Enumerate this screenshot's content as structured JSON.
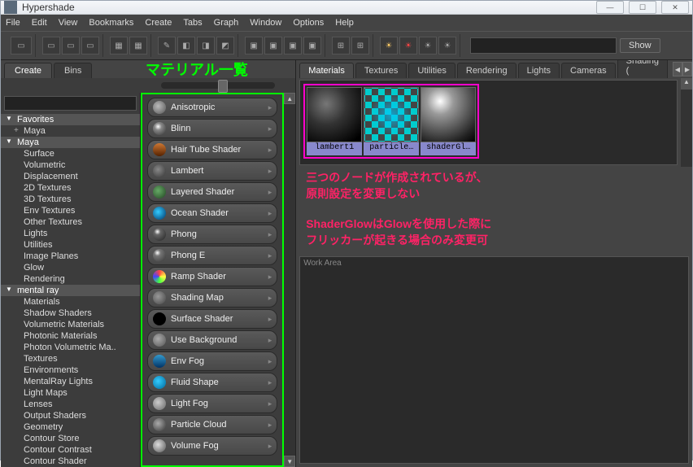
{
  "window": {
    "title": "Hypershade"
  },
  "menubar": [
    "File",
    "Edit",
    "View",
    "Bookmarks",
    "Create",
    "Tabs",
    "Graph",
    "Window",
    "Options",
    "Help"
  ],
  "toolbar": {
    "show": "Show"
  },
  "left": {
    "tabs": [
      {
        "label": "Create",
        "active": true
      },
      {
        "label": "Bins",
        "active": false
      }
    ],
    "annot_materials": "マテリアル一覧",
    "tree": [
      {
        "label": "Favorites",
        "type": "hdr"
      },
      {
        "label": "Maya",
        "type": "sub"
      },
      {
        "label": "Maya",
        "type": "hdr"
      },
      {
        "label": "Surface",
        "type": "leaf"
      },
      {
        "label": "Volumetric",
        "type": "leaf"
      },
      {
        "label": "Displacement",
        "type": "leaf"
      },
      {
        "label": "2D Textures",
        "type": "leaf"
      },
      {
        "label": "3D Textures",
        "type": "leaf"
      },
      {
        "label": "Env Textures",
        "type": "leaf"
      },
      {
        "label": "Other Textures",
        "type": "leaf"
      },
      {
        "label": "Lights",
        "type": "leaf"
      },
      {
        "label": "Utilities",
        "type": "leaf"
      },
      {
        "label": "Image Planes",
        "type": "leaf"
      },
      {
        "label": "Glow",
        "type": "leaf"
      },
      {
        "label": "Rendering",
        "type": "leaf"
      },
      {
        "label": "mental ray",
        "type": "hdr"
      },
      {
        "label": "Materials",
        "type": "leaf"
      },
      {
        "label": "Shadow Shaders",
        "type": "leaf"
      },
      {
        "label": "Volumetric Materials",
        "type": "leaf"
      },
      {
        "label": "Photonic Materials",
        "type": "leaf"
      },
      {
        "label": "Photon Volumetric Ma..",
        "type": "leaf"
      },
      {
        "label": "Textures",
        "type": "leaf"
      },
      {
        "label": "Environments",
        "type": "leaf"
      },
      {
        "label": "MentalRay Lights",
        "type": "leaf"
      },
      {
        "label": "Light Maps",
        "type": "leaf"
      },
      {
        "label": "Lenses",
        "type": "leaf"
      },
      {
        "label": "Output Shaders",
        "type": "leaf"
      },
      {
        "label": "Geometry",
        "type": "leaf"
      },
      {
        "label": "Contour Store",
        "type": "leaf"
      },
      {
        "label": "Contour Contrast",
        "type": "leaf"
      },
      {
        "label": "Contour Shader",
        "type": "leaf"
      }
    ],
    "materials": [
      {
        "name": "Anisotropic",
        "color": "radial-gradient(circle at 40% 40%,#bbb,#555)"
      },
      {
        "name": "Blinn",
        "color": "radial-gradient(circle at 40% 35%,#fff,#888 30%,#333)"
      },
      {
        "name": "Hair Tube Shader",
        "color": "linear-gradient(#cc7733,#552200)"
      },
      {
        "name": "Lambert",
        "color": "radial-gradient(circle at 40% 40%,#888,#333)"
      },
      {
        "name": "Layered Shader",
        "color": "radial-gradient(circle at 40% 40%,#6a6,#242)"
      },
      {
        "name": "Ocean Shader",
        "color": "radial-gradient(circle at 40% 40%,#3cf,#036)"
      },
      {
        "name": "Phong",
        "color": "radial-gradient(circle at 35% 30%,#fff,#666 25%,#222)"
      },
      {
        "name": "Phong E",
        "color": "radial-gradient(circle at 35% 30%,#fff,#777 25%,#333)"
      },
      {
        "name": "Ramp Shader",
        "color": "conic-gradient(#f44,#ff4,#4f4,#44f,#f44)"
      },
      {
        "name": "Shading Map",
        "color": "radial-gradient(circle at 40% 40%,#999,#444)"
      },
      {
        "name": "Surface Shader",
        "color": "#000"
      },
      {
        "name": "Use Background",
        "color": "radial-gradient(circle at 40% 40%,#aaa,#555)"
      },
      {
        "name": "Env Fog",
        "color": "linear-gradient(#39c,#036)"
      },
      {
        "name": "Fluid Shape",
        "color": "radial-gradient(circle at 40% 40%,#3cf,#069)"
      },
      {
        "name": "Light Fog",
        "color": "radial-gradient(circle at 40% 40%,#ccc,#666)"
      },
      {
        "name": "Particle Cloud",
        "color": "radial-gradient(circle at 40% 40%,#aaa,#333)"
      },
      {
        "name": "Volume Fog",
        "color": "radial-gradient(circle at 40% 40%,#ddd,#555)"
      }
    ]
  },
  "right": {
    "tabs": [
      {
        "label": "Materials",
        "active": true
      },
      {
        "label": "Textures",
        "active": false
      },
      {
        "label": "Utilities",
        "active": false
      },
      {
        "label": "Rendering",
        "active": false
      },
      {
        "label": "Lights",
        "active": false
      },
      {
        "label": "Cameras",
        "active": false
      },
      {
        "label": "Shading (",
        "active": false
      }
    ],
    "nodes": [
      {
        "label": "lambert1",
        "thumb": "sphere-dark"
      },
      {
        "label": "particle…",
        "thumb": "checker"
      },
      {
        "label": "shaderGl…",
        "thumb": "sphere-grey"
      }
    ],
    "annot1": "三つのノードが作成されているが、\n原則設定を変更しない",
    "annot2": "ShaderGlowはGlowを使用した際に\nフリッカーが起きる場合のみ変更可",
    "work_area": "Work Area"
  }
}
